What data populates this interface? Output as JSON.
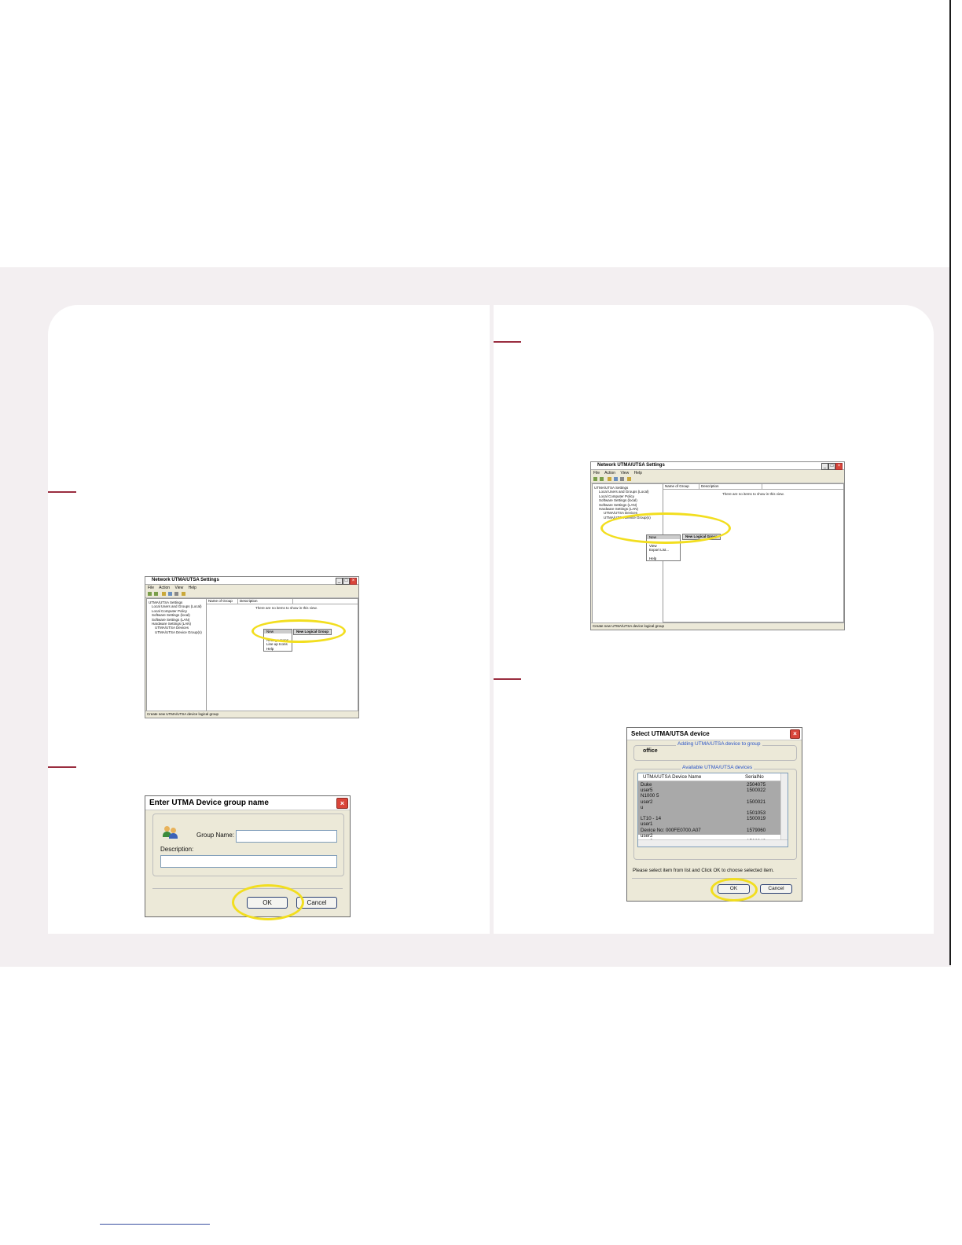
{
  "windows": {
    "mmc1": {
      "title": "Network UTMA/UTSA Settings",
      "menu": "File Action View Help",
      "col_name": "Name of Group",
      "col_desc": "Description",
      "empty_msg": "There are no items to show in this view.",
      "tree": [
        "UTMA/UTSA Settings",
        "Local Users and Groups (Local)",
        "Local Computer Policy",
        "Software Settings (local)",
        "Software Settings (LAN)",
        "Hardware Settings (LAN)",
        "UTMA/UTSA Devices",
        "UTMA/UTSA Device Group(s)"
      ],
      "ctx_items": [
        "New",
        "Arrange Icons",
        "Line up Icons",
        "Help"
      ],
      "submenu": "New Logical Group",
      "status": "Create new UTMA/UTSA device logical group"
    },
    "mmc2": {
      "title": "Network UTMA/UTSA Settings",
      "menu": "File Action View Help",
      "col_name": "Name of Group",
      "col_desc": "Description",
      "empty_msg": "There are no items to show in this view.",
      "tree": [
        "UTMA/UTSA Settings",
        "Local Users and Groups (Local)",
        "Local Computer Policy",
        "Software Settings (local)",
        "Software Settings (LAN)",
        "Hardware Settings (LAN)",
        "UTMA/UTSA Devices",
        "UTMA/UTSA Device Group(s)"
      ],
      "ctx_items": [
        "New",
        "View",
        "Export List...",
        "Help"
      ],
      "submenu": "New Logical Group",
      "status": "Create new UTMA/UTSA device logical group"
    }
  },
  "group_dialog": {
    "title": "Enter UTMA Device group name",
    "group_label": "Group Name:",
    "desc_label": "Description:",
    "ok": "OK",
    "cancel": "Cancel"
  },
  "select_dialog": {
    "title": "Select UTMA/UTSA device",
    "adding_label": "Adding UTMA/UTSA device to group",
    "group_value": "office",
    "available_label": "Available UTMA/UTSA devices",
    "col_name": "UTMA/UTSA Device Name",
    "col_serial": "SerialNo",
    "names": [
      "Duke",
      "user5",
      "N1000 5",
      "user2",
      "u",
      "",
      "LT10 - 14",
      "user1",
      "Device No: 000FE0700.A07",
      "user2",
      "user3"
    ],
    "serials": [
      "2504075",
      "1500022",
      "",
      "1500021",
      "",
      "1501053",
      "1500019",
      "",
      "1579060",
      "",
      "1566043"
    ],
    "hint": "Please select item from list and Click OK to choose selected item.",
    "ok": "OK",
    "cancel": "Cancel"
  }
}
